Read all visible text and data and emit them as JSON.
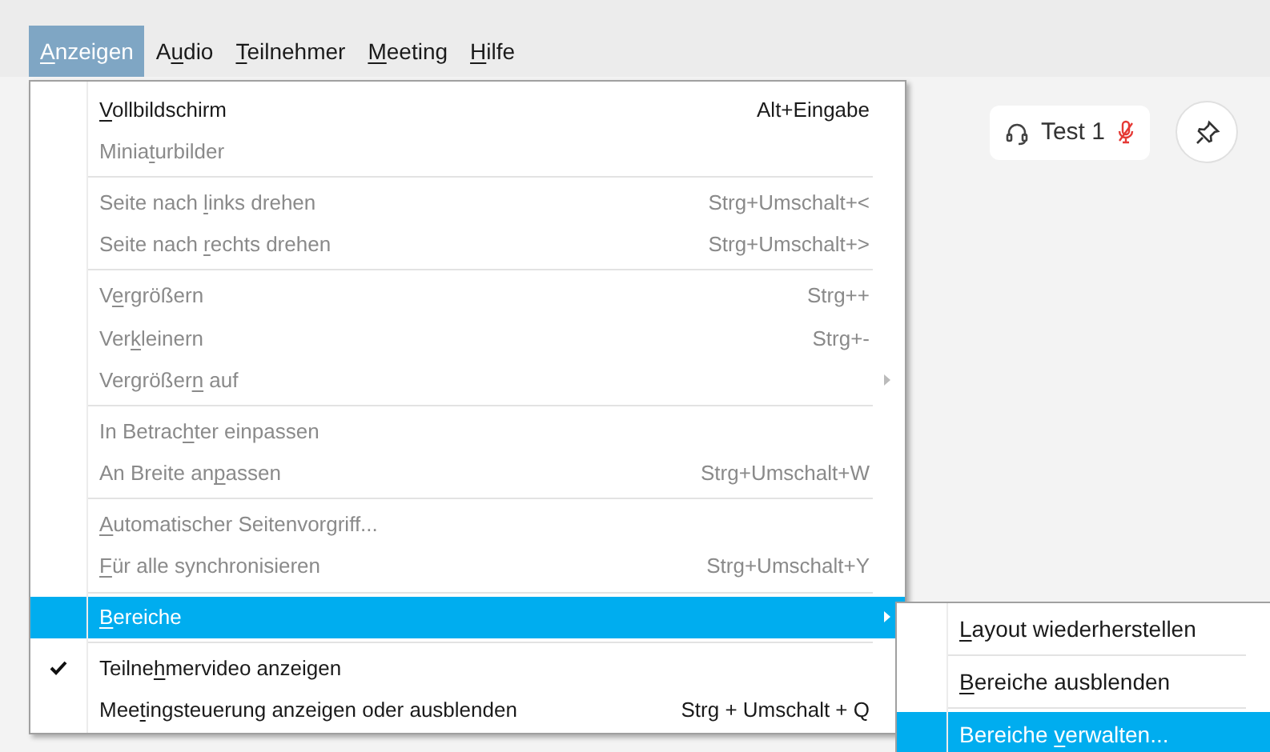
{
  "menubar": [
    {
      "label": {
        "key": "A",
        "after": "nzeigen"
      },
      "selected": true
    },
    {
      "label": {
        "before": "A",
        "key": "u",
        "after": "dio"
      },
      "selected": false
    },
    {
      "label": {
        "key": "T",
        "after": "eilnehmer"
      },
      "selected": false
    },
    {
      "label": {
        "key": "M",
        "after": "eeting"
      },
      "selected": false
    },
    {
      "label": {
        "key": "H",
        "after": "ilfe"
      },
      "selected": false
    }
  ],
  "menu": [
    {
      "kind": "item",
      "label": {
        "key": "V",
        "after": "ollbildschirm"
      },
      "shortcut": "Alt+Eingabe",
      "disabled": false,
      "checked": false,
      "selected": false,
      "submenu": false
    },
    {
      "kind": "item",
      "label": {
        "before": "Minia",
        "key": "t",
        "after": "urbilder"
      },
      "disabled": true,
      "checked": false,
      "selected": false,
      "submenu": false
    },
    {
      "kind": "separator"
    },
    {
      "kind": "item",
      "label": {
        "before": "Seite nach ",
        "key": "l",
        "after": "inks drehen"
      },
      "shortcut": "Strg+Umschalt+<",
      "disabled": true,
      "checked": false,
      "selected": false,
      "submenu": false
    },
    {
      "kind": "item",
      "label": {
        "before": "Seite nach ",
        "key": "r",
        "after": "echts drehen"
      },
      "shortcut": "Strg+Umschalt+>",
      "disabled": true,
      "checked": false,
      "selected": false,
      "submenu": false
    },
    {
      "kind": "separator"
    },
    {
      "kind": "item",
      "label": {
        "before": "V",
        "key": "e",
        "after": "rgrößern"
      },
      "shortcut": "Strg++",
      "disabled": true,
      "checked": false,
      "selected": false,
      "submenu": false
    },
    {
      "kind": "item",
      "label": {
        "before": "Ver",
        "key": "k",
        "after": "leinern"
      },
      "shortcut": "Strg+-",
      "disabled": true,
      "checked": false,
      "selected": false,
      "submenu": false
    },
    {
      "kind": "item",
      "label": {
        "before": "Vergrößer",
        "key": "n",
        "after": " auf"
      },
      "disabled": true,
      "checked": false,
      "selected": false,
      "submenu": true
    },
    {
      "kind": "separator"
    },
    {
      "kind": "item",
      "label": {
        "before": "In Betrac",
        "key": "h",
        "after": "ter einpassen"
      },
      "disabled": true,
      "checked": false,
      "selected": false,
      "submenu": false
    },
    {
      "kind": "item",
      "label": {
        "before": "An Breite an",
        "key": "p",
        "after": "assen"
      },
      "shortcut": "Strg+Umschalt+W",
      "disabled": true,
      "checked": false,
      "selected": false,
      "submenu": false
    },
    {
      "kind": "separator"
    },
    {
      "kind": "item",
      "label": {
        "key": "A",
        "after": "utomatischer Seitenvorgriff..."
      },
      "disabled": true,
      "checked": false,
      "selected": false,
      "submenu": false
    },
    {
      "kind": "item",
      "label": {
        "key": "F",
        "after": "ür alle synchronisieren"
      },
      "shortcut": "Strg+Umschalt+Y",
      "disabled": true,
      "checked": false,
      "selected": false,
      "submenu": false
    },
    {
      "kind": "separator"
    },
    {
      "kind": "item",
      "label": {
        "key": "B",
        "after": "ereiche"
      },
      "disabled": false,
      "checked": false,
      "selected": true,
      "submenu": true
    },
    {
      "kind": "separator"
    },
    {
      "kind": "item",
      "label": {
        "before": "Teilne",
        "key": "h",
        "after": "mervideo anzeigen"
      },
      "disabled": false,
      "checked": true,
      "selected": false,
      "submenu": false
    },
    {
      "kind": "item",
      "label": {
        "before": "Mee",
        "key": "t",
        "after": "ingsteuerung anzeigen oder ausblenden"
      },
      "shortcut": "Strg + Umschalt + Q",
      "disabled": false,
      "checked": false,
      "selected": false,
      "submenu": false
    }
  ],
  "submenu": [
    {
      "kind": "item",
      "label": {
        "key": "L",
        "after": "ayout wiederherstellen"
      },
      "selected": false
    },
    {
      "kind": "separator"
    },
    {
      "kind": "item",
      "label": {
        "key": "B",
        "after": "ereiche ausblenden"
      },
      "selected": false
    },
    {
      "kind": "separator"
    },
    {
      "kind": "item",
      "label": {
        "before": "Bereiche ",
        "key": "v",
        "after": "erwalten..."
      },
      "selected": true
    }
  ],
  "participant": {
    "name": "Test 1",
    "muted": true
  }
}
